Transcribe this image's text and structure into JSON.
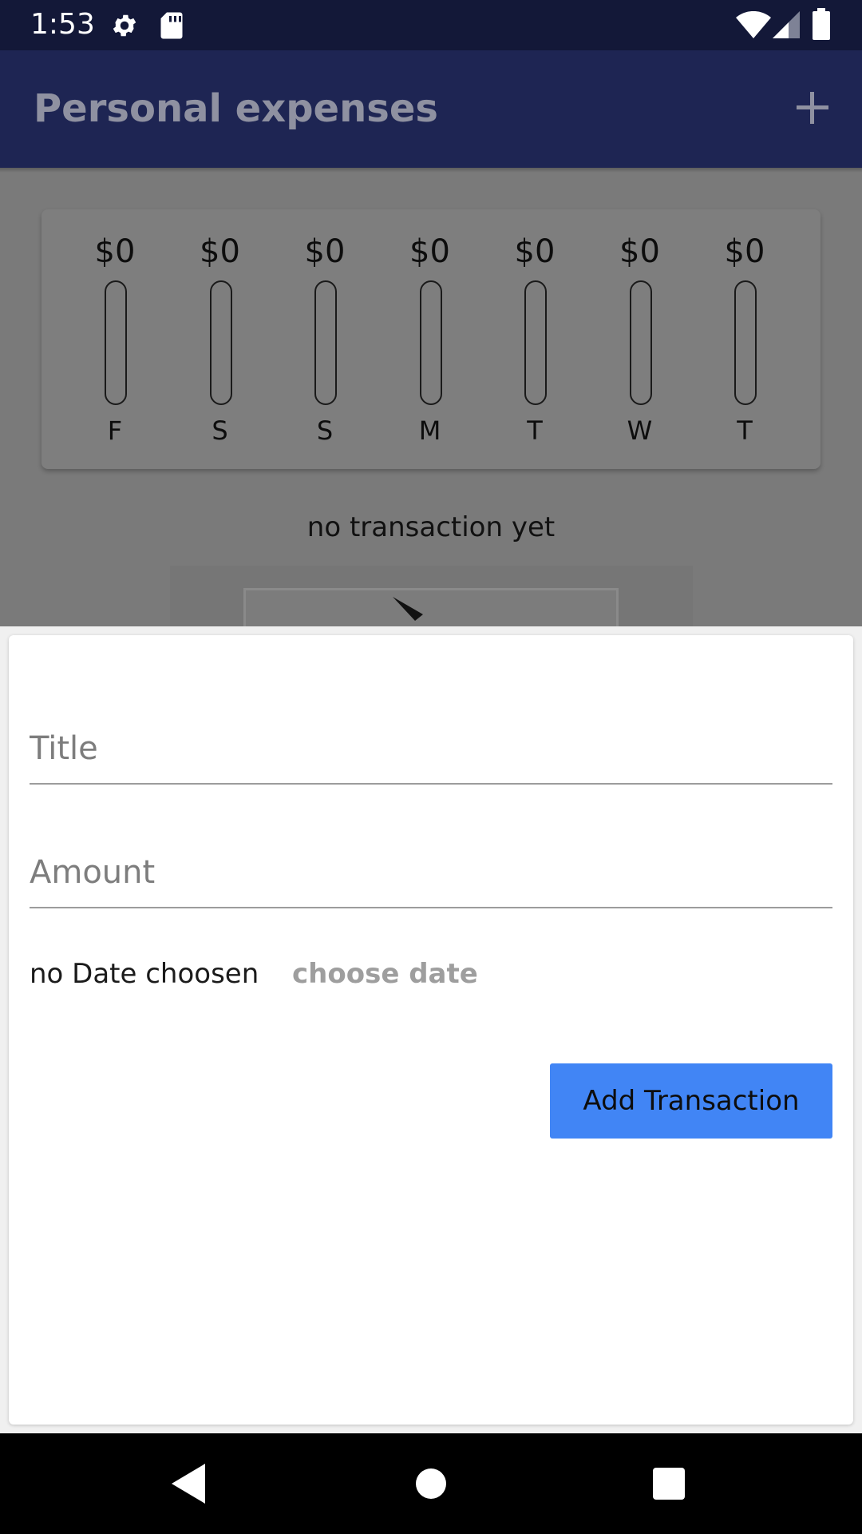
{
  "status_bar": {
    "time": "1:53",
    "icons": [
      "gear-icon",
      "sd-card-icon",
      "wifi-icon",
      "signal-icon",
      "battery-icon"
    ]
  },
  "app_bar": {
    "title": "Personal expenses",
    "action_icon": "plus-icon"
  },
  "chart_data": {
    "type": "bar",
    "categories": [
      "F",
      "S",
      "S",
      "M",
      "T",
      "W",
      "T"
    ],
    "values": [
      0,
      0,
      0,
      0,
      0,
      0,
      0
    ],
    "value_labels": [
      "$0",
      "$0",
      "$0",
      "$0",
      "$0",
      "$0",
      "$0"
    ]
  },
  "empty_state": {
    "text": "no transaction yet"
  },
  "form": {
    "title_placeholder": "Title",
    "amount_placeholder": "Amount",
    "date_status": "no Date choosen",
    "choose_date_label": "choose date",
    "submit_label": "Add Transaction"
  },
  "nav_bar": {
    "icons": [
      "back-icon",
      "home-icon",
      "recents-icon"
    ]
  },
  "colors": {
    "app_bar": "#1e2553",
    "status_bar": "#131838",
    "accent_button": "#4185f5",
    "scrim": "#7a7a7a"
  }
}
